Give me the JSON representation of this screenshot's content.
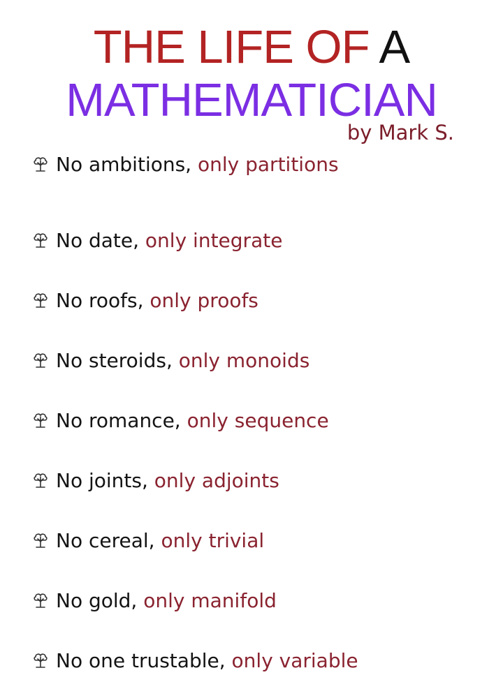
{
  "title": {
    "line1_red": "THE LIFE OF",
    "line1_black": "A",
    "line2": "MATHEMATICIAN"
  },
  "byline": "by Mark S.",
  "colors": {
    "title_red": "#b32323",
    "title_purple": "#7b2ee3",
    "accent_maroon": "#8a2330",
    "text_dark": "#141414"
  },
  "bullet_icon": "cloud-tree-icon",
  "items": [
    {
      "lead": "No ambitions,",
      "rest": "only partitions"
    },
    {
      "lead": "No date,",
      "rest": "only integrate"
    },
    {
      "lead": "No roofs,",
      "rest": "only proofs"
    },
    {
      "lead": "No steroids,",
      "rest": "only monoids"
    },
    {
      "lead": "No romance,",
      "rest": "only sequence"
    },
    {
      "lead": "No joints,",
      "rest": "only adjoints"
    },
    {
      "lead": "No cereal,",
      "rest": "only trivial"
    },
    {
      "lead": "No gold,",
      "rest": "only manifold"
    },
    {
      "lead": "No one trustable,",
      "rest": "only variable"
    }
  ]
}
